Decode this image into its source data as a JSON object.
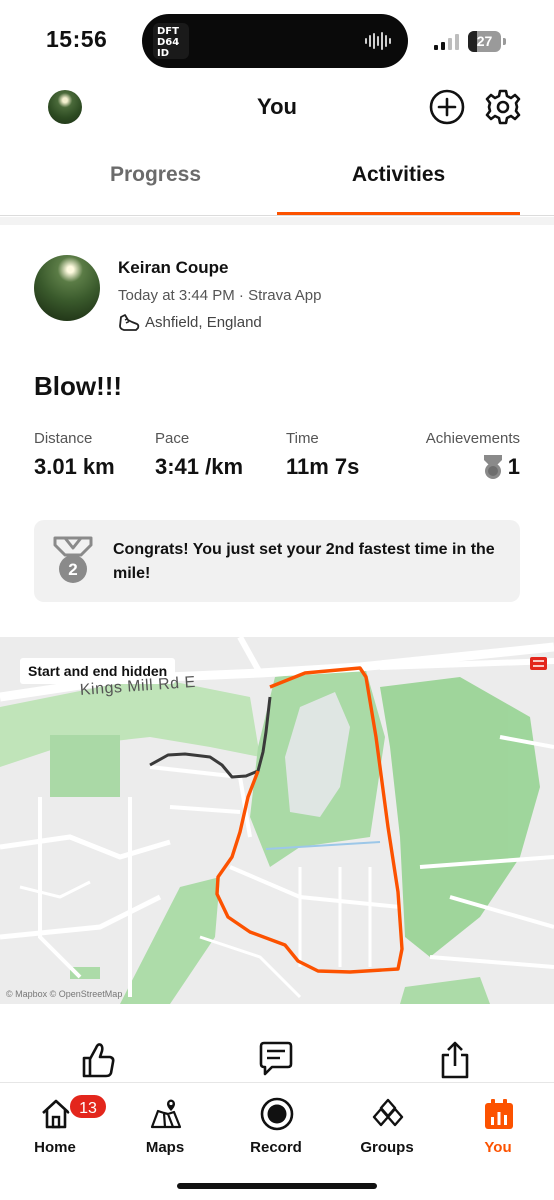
{
  "status_bar": {
    "time": "15:56",
    "now_playing_art_text": "DFT D64 ID",
    "battery_level": "27",
    "battery_fraction": 0.27
  },
  "header": {
    "title": "You",
    "add_icon": "plus-circle-icon",
    "settings_icon": "gear-icon"
  },
  "tabs": [
    {
      "label": "Progress",
      "active": false
    },
    {
      "label": "Activities",
      "active": true
    }
  ],
  "activity": {
    "athlete_name": "Keiran Coupe",
    "meta": "Today at 3:44 PM · Strava App",
    "sport_icon": "running-shoe-icon",
    "location": "Ashfield, England",
    "title": "Blow!!!",
    "stats": {
      "distance": {
        "label": "Distance",
        "value": "3.01 km"
      },
      "pace": {
        "label": "Pace",
        "value": "3:41 /km"
      },
      "time": {
        "label": "Time",
        "value": "11m 7s"
      },
      "achievements": {
        "label": "Achievements",
        "value": "1"
      }
    },
    "highlight": {
      "medal_number": "2",
      "text": "Congrats! You just set your 2nd fastest time in the mile!"
    }
  },
  "map": {
    "privacy_chip": "Start and end hidden",
    "road_label": "Kings Mill Rd E",
    "attribution": "© Mapbox © OpenStreetMap",
    "route_color": "#fc5200"
  },
  "actions": {
    "kudos_icon": "thumbs-up-icon",
    "comment_icon": "comment-icon",
    "share_icon": "share-icon"
  },
  "bottom_nav": {
    "items": [
      {
        "label": "Home",
        "icon": "home-icon",
        "badge": "13"
      },
      {
        "label": "Maps",
        "icon": "map-icon"
      },
      {
        "label": "Record",
        "icon": "record-icon"
      },
      {
        "label": "Groups",
        "icon": "groups-icon"
      },
      {
        "label": "You",
        "icon": "you-icon",
        "active": true
      }
    ]
  },
  "colors": {
    "accent": "#fc5200",
    "badge": "#e3261c"
  }
}
